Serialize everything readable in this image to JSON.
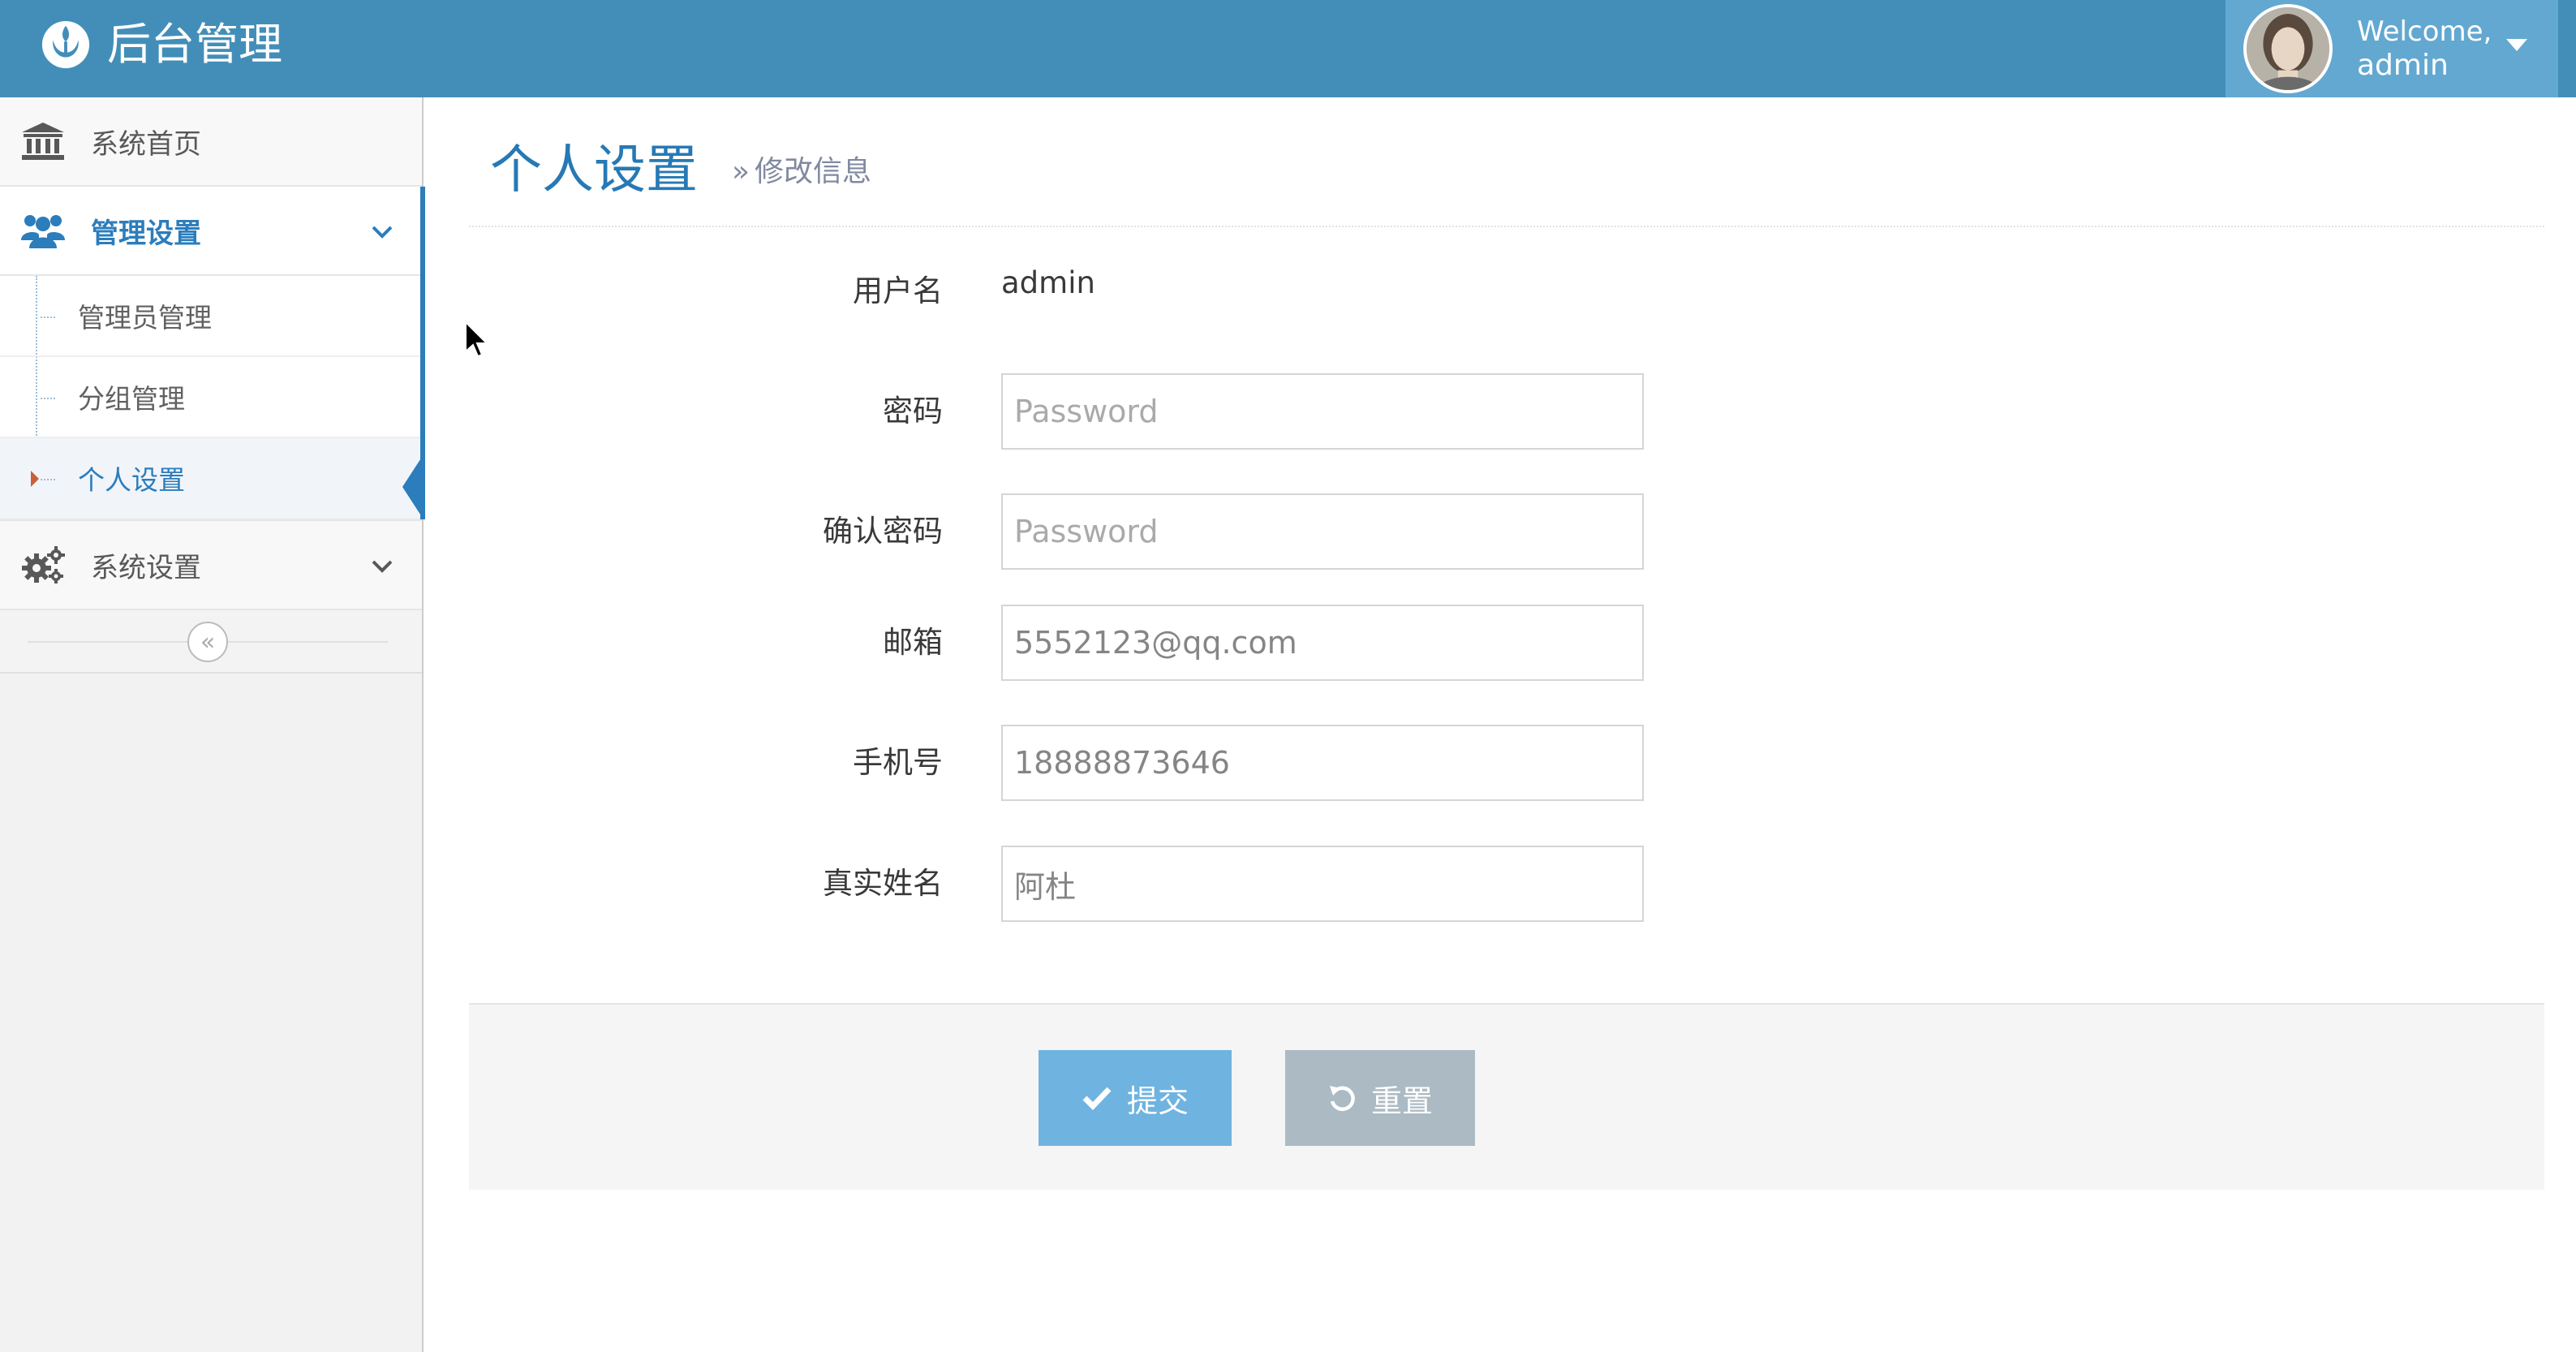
{
  "header": {
    "brand_title": "后台管理",
    "welcome_label": "Welcome,",
    "username": "admin"
  },
  "sidebar": {
    "items": [
      {
        "label": "系统首页",
        "icon": "bank-icon"
      },
      {
        "label": "管理设置",
        "icon": "users-icon",
        "expanded": true,
        "children": [
          {
            "label": "管理员管理"
          },
          {
            "label": "分组管理"
          },
          {
            "label": "个人设置",
            "active": true
          }
        ]
      },
      {
        "label": "系统设置",
        "icon": "cogs-icon"
      }
    ],
    "collapse_symbol": "«"
  },
  "page": {
    "title": "个人设置",
    "breadcrumb_separator": "»",
    "subtitle": "修改信息"
  },
  "form": {
    "username_label": "用户名",
    "username_value": "admin",
    "password_label": "密码",
    "password_placeholder": "Password",
    "confirm_label": "确认密码",
    "confirm_placeholder": "Password",
    "email_label": "邮箱",
    "email_value": "5552123@qq.com",
    "phone_label": "手机号",
    "phone_value": "18888873646",
    "realname_label": "真实姓名",
    "realname_value": "阿杜",
    "submit_label": "提交",
    "reset_label": "重置"
  },
  "colors": {
    "navbar": "#438eb9",
    "user_box": "#62a8d1",
    "accent": "#2b7dbc",
    "submit_button": "#6fb3e0",
    "reset_button": "#abbac3"
  }
}
